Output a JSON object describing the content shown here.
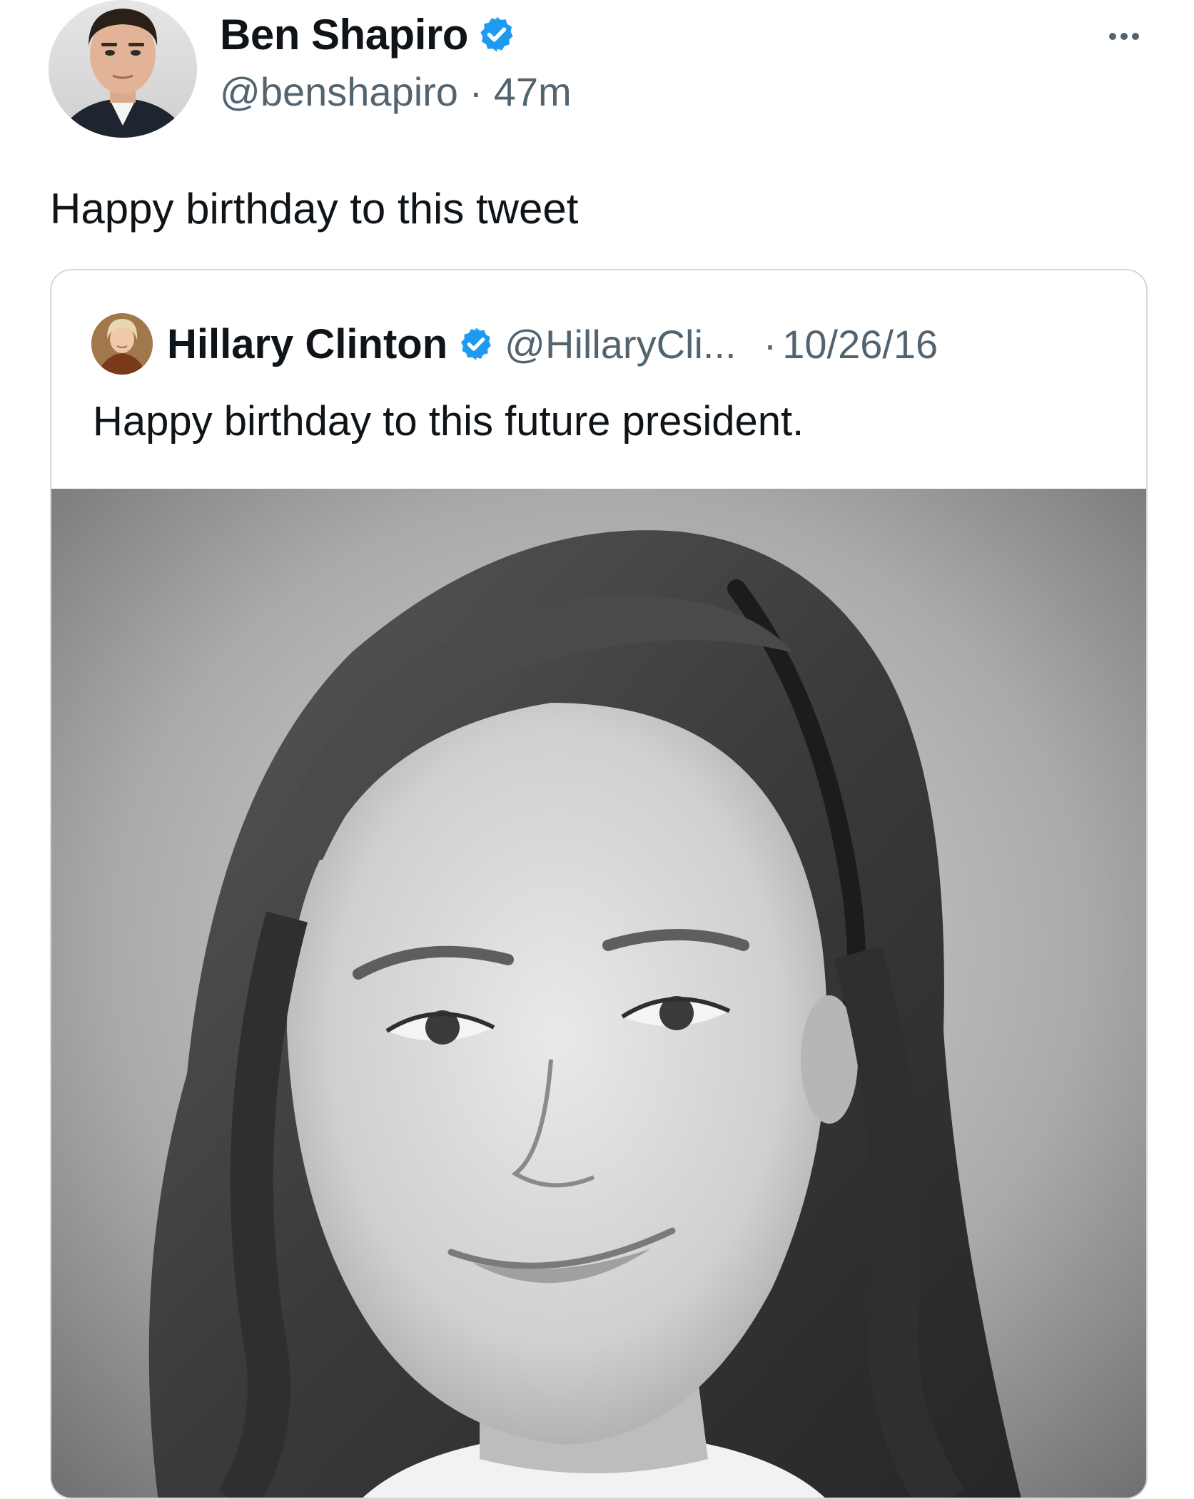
{
  "tweet": {
    "author_name": "Ben Shapiro",
    "handle": "@benshapiro",
    "separator": "·",
    "time": "47m",
    "text": "Happy birthday to this tweet",
    "avatar_icon": "user-avatar-photo",
    "verified_icon": "verified-badge-icon",
    "more_icon": "more-options-icon"
  },
  "quoted_tweet": {
    "author_name": "Hillary Clinton",
    "handle": "@HillaryCli...",
    "separator": "·",
    "date": "10/26/16",
    "text": "Happy birthday to this future president.",
    "avatar_icon": "user-avatar-photo",
    "verified_icon": "verified-badge-icon",
    "media": {
      "type": "photo",
      "style": "black-and-white portrait"
    }
  },
  "colors": {
    "text_primary": "#0f1419",
    "text_secondary": "#536471",
    "verified_blue": "#1d9bf0",
    "card_border": "#cfd9de",
    "background": "#ffffff"
  }
}
